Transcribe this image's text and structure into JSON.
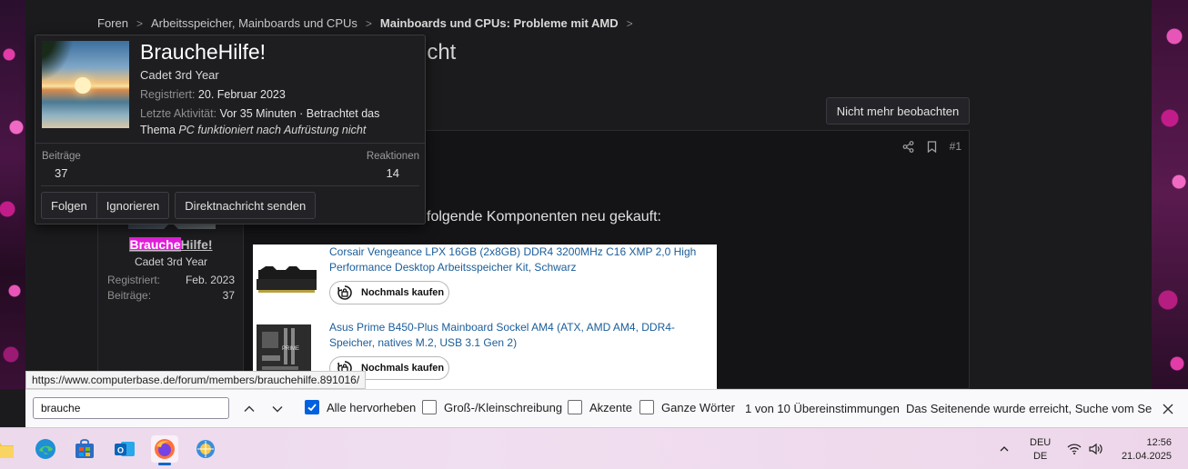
{
  "breadcrumb": {
    "items": [
      "Foren",
      "Arbeitsspeicher, Mainboards und CPUs",
      "Mainboards und CPUs: Probleme mit AMD"
    ],
    "separator": ">"
  },
  "thread": {
    "title_visible_tail": "icht",
    "watch_button": "Nicht mehr beobachten"
  },
  "profile_card": {
    "name": "BraucheHilfe!",
    "rank": "Cadet 3rd Year",
    "registered_label": "Registriert:",
    "registered_value": "20. Februar 2023",
    "activity_label": "Letzte Aktivität:",
    "activity_value": "Vor 35 Minuten · Betrachtet das",
    "activity_value2": "Thema",
    "activity_thread": "PC funktioniert nach Aufrüstung nicht",
    "posts_label": "Beiträge",
    "posts_value": "37",
    "reactions_label": "Reaktionen",
    "reactions_value": "14",
    "btn_follow": "Folgen",
    "btn_ignore": "Ignorieren",
    "btn_message": "Direktnachricht senden"
  },
  "post": {
    "author_highlight": "Brauche",
    "author_rest": "Hilfe!",
    "author_rank": "Cadet 3rd Year",
    "registered_label": "Registriert:",
    "registered_value": "Feb. 2023",
    "posts_label": "Beiträge:",
    "posts_value": "37",
    "number": "#1",
    "text_visible": "folgende Komponenten neu gekauft:",
    "products": [
      {
        "title": "Corsair Vengeance LPX 16GB (2x8GB) DDR4 3200MHz C16 XMP 2,0 High Performance Desktop Arbeitsspeicher Kit, Schwarz",
        "button": "Nochmals kaufen"
      },
      {
        "title": "Asus Prime B450-Plus Mainboard Sockel AM4 (ATX, AMD AM4, DDR4-Speicher, natives M.2, USB 3.1 Gen 2)",
        "button": "Nochmals kaufen"
      }
    ]
  },
  "status_url": "https://www.computerbase.de/forum/members/brauchehilfe.891016/",
  "findbar": {
    "query": "brauche",
    "highlight_all": "Alle hervorheben",
    "match_case": "Groß-/Kleinschreibung",
    "diacritics": "Akzente",
    "whole_words": "Ganze Wörter",
    "match_count": "1 von 10 Übereinstimmungen",
    "status": "Das Seitenende wurde erreicht, Suche vom Seitenan"
  },
  "taskbar": {
    "lang_line1": "DEU",
    "lang_line2": "DE",
    "time": "12:56",
    "date": "21.04.2025"
  },
  "colors": {
    "highlight": "#e020d8",
    "link": "#1a5d9a",
    "checkbox_on": "#0061e0"
  }
}
